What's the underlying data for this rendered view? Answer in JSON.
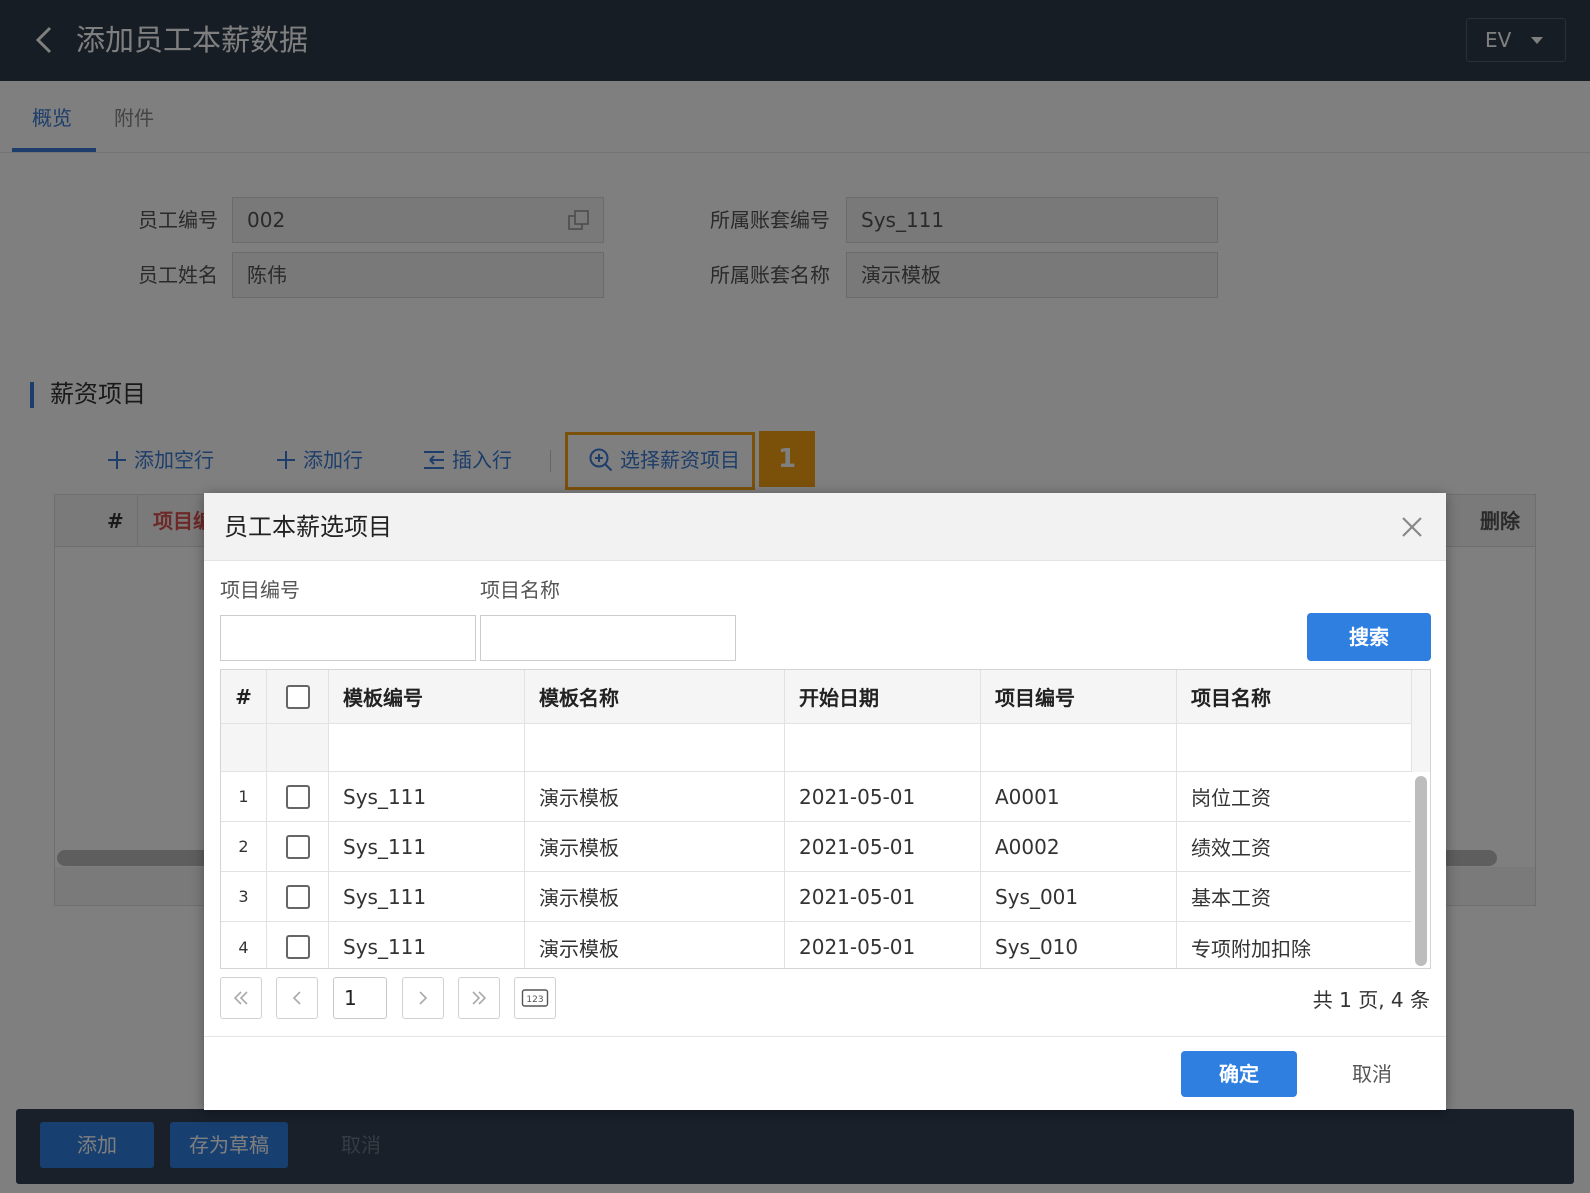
{
  "header": {
    "title": "添加员工本薪数据",
    "lang": "EV"
  },
  "tabs": [
    {
      "label": "概览",
      "active": true
    },
    {
      "label": "附件",
      "active": false
    }
  ],
  "form": {
    "employee_no": {
      "label": "员工编号",
      "value": "002"
    },
    "employee_name": {
      "label": "员工姓名",
      "value": "陈伟"
    },
    "account_set_no": {
      "label": "所属账套编号",
      "value": "Sys_111"
    },
    "account_set_name": {
      "label": "所属账套名称",
      "value": "演示模板"
    }
  },
  "section": {
    "title": "薪资项目"
  },
  "toolbar": {
    "add_empty_row": "添加空行",
    "add_row": "添加行",
    "insert_row": "插入行",
    "select_items": "选择薪资项目"
  },
  "callout": {
    "number": "1"
  },
  "background_grid": {
    "col_num": "#",
    "col_item": "项目编",
    "col_delete": "删除"
  },
  "footer": {
    "add": "添加",
    "save_draft": "存为草稿",
    "cancel": "取消"
  },
  "dialog": {
    "title": "员工本薪选项目",
    "filters": {
      "item_no_label": "项目编号",
      "item_name_label": "项目名称",
      "item_no_value": "",
      "item_name_value": ""
    },
    "search_label": "搜索",
    "columns": {
      "num": "#",
      "template_no": "模板编号",
      "template_name": "模板名称",
      "start_date": "开始日期",
      "item_no": "项目编号",
      "item_name": "项目名称"
    },
    "rows": [
      {
        "num": "1",
        "template_no": "Sys_111",
        "template_name": "演示模板",
        "start_date": "2021-05-01",
        "item_no": "A0001",
        "item_name": "岗位工资",
        "checked": false
      },
      {
        "num": "2",
        "template_no": "Sys_111",
        "template_name": "演示模板",
        "start_date": "2021-05-01",
        "item_no": "A0002",
        "item_name": "绩效工资",
        "checked": false
      },
      {
        "num": "3",
        "template_no": "Sys_111",
        "template_name": "演示模板",
        "start_date": "2021-05-01",
        "item_no": "Sys_001",
        "item_name": "基本工资",
        "checked": false
      },
      {
        "num": "4",
        "template_no": "Sys_111",
        "template_name": "演示模板",
        "start_date": "2021-05-01",
        "item_no": "Sys_010",
        "item_name": "专项附加扣除",
        "checked": false
      }
    ],
    "pager": {
      "page": "1",
      "info": "共 1 页, 4 条",
      "page_size_icon": "123"
    },
    "ok_label": "确定",
    "cancel_label": "取消"
  },
  "colors": {
    "accent": "#2f7fe0",
    "highlight": "#f6a214",
    "titlebar": "#2f3a4a"
  }
}
